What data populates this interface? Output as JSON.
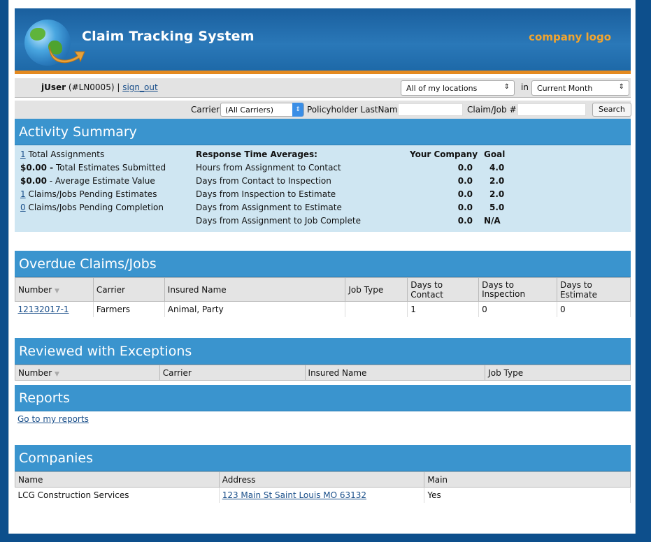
{
  "header": {
    "app_title": "Claim Tracking System",
    "logo_text": "company logo"
  },
  "userbar": {
    "username": "jUser",
    "user_id": "(#LN0005)",
    "separator": "|",
    "sign_out": "sign_out",
    "location_select": "All of my locations",
    "in_label": "in",
    "period_select": "Current Month"
  },
  "filter": {
    "carrier_label": "Carrier",
    "carrier_value": "(All Carriers)",
    "policyholder_label": "Policyholder LastName",
    "claim_label": "Claim/Job #",
    "search_button": "Search"
  },
  "activity": {
    "title": "Activity Summary",
    "left": [
      {
        "link": "1",
        "text": " Total Assignments"
      },
      {
        "bold": "$0.00 -",
        "text": " Total Estimates Submitted"
      },
      {
        "bold": "$0.00",
        "text": " - Average Estimate Value"
      },
      {
        "link": "1",
        "text": " Claims/Jobs Pending Estimates"
      },
      {
        "link": "0",
        "text": " Claims/Jobs Pending Completion"
      }
    ],
    "response_header": "Response Time Averages:",
    "your_company_header": "Your Company",
    "goal_header": "Goal",
    "rows": [
      {
        "label": "Hours from Assignment to Contact",
        "company": "0.0",
        "goal": "4.0"
      },
      {
        "label": "Days from Contact to Inspection",
        "company": "0.0",
        "goal": "2.0"
      },
      {
        "label": "Days from Inspection to Estimate",
        "company": "0.0",
        "goal": "2.0"
      },
      {
        "label": "Days from Assignment to Estimate",
        "company": "0.0",
        "goal": "5.0"
      },
      {
        "label": "Days from Assignment to Job Complete",
        "company": "0.0",
        "goal": "N/A"
      }
    ]
  },
  "overdue": {
    "title": "Overdue Claims/Jobs",
    "columns": [
      "Number",
      "Carrier",
      "Insured Name",
      "Job Type",
      "Days to Contact",
      "Days to Inspection",
      "Days to Estimate"
    ],
    "rows": [
      [
        "12132017-1",
        "Farmers",
        "Animal, Party",
        "",
        "1",
        "0",
        "0"
      ]
    ]
  },
  "reviewed": {
    "title": "Reviewed with Exceptions",
    "columns": [
      "Number",
      "Carrier",
      "Insured Name",
      "Job Type"
    ]
  },
  "reports": {
    "title": "Reports",
    "link": "Go to my reports"
  },
  "companies": {
    "title": "Companies",
    "columns": [
      "Name",
      "Address",
      "Main"
    ],
    "rows": [
      [
        "LCG Construction Services",
        "123 Main St Saint Louis MO 63132",
        "Yes"
      ]
    ]
  }
}
